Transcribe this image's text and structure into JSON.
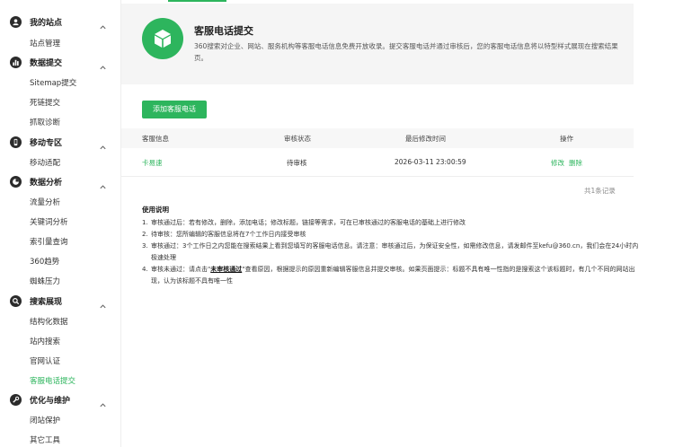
{
  "sidebar": {
    "sections": [
      {
        "title": "我的站点",
        "items": [
          "站点管理"
        ]
      },
      {
        "title": "数据提交",
        "items": [
          "Sitemap提交",
          "死链提交",
          "抓取诊断"
        ]
      },
      {
        "title": "移动专区",
        "items": [
          "移动适配"
        ]
      },
      {
        "title": "数据分析",
        "items": [
          "流量分析",
          "关键词分析",
          "索引量查询",
          "360趋势",
          "蜘蛛压力"
        ]
      },
      {
        "title": "搜索展现",
        "items": [
          "结构化数据",
          "站内搜索",
          "官网认证",
          "客服电话提交"
        ]
      },
      {
        "title": "优化与维护",
        "items": [
          "闭站保护",
          "其它工具"
        ]
      }
    ],
    "active_item": "客服电话提交"
  },
  "header": {
    "title": "客服电话提交",
    "description": "360搜索对企业、网站、服务机构等客服电话信息免费开放收录。提交客服电话并通过审核后，您的客服电话信息将以特型样式展现在搜索结果页。"
  },
  "toolbar": {
    "add_label": "添加客服电话"
  },
  "table": {
    "headers": [
      "客服信息",
      "审核状态",
      "最后修改时间",
      "操作"
    ],
    "rows": [
      {
        "info": "卡易速",
        "status": "待审核",
        "time": "2026-03-11 23:00:59",
        "edit": "修改",
        "delete": "删除"
      }
    ],
    "total": "共1条记录"
  },
  "notes": {
    "title": "使用说明",
    "items": [
      {
        "num": "1.",
        "text": "审核通过后：若有修改，删除，添加电话；修改标题，链接等需求，可在已审核通过的客服电话的基础上进行修改"
      },
      {
        "num": "2.",
        "text": "待审核：您所编辑的客服信息将在7个工作日内接受审核"
      },
      {
        "num": "3.",
        "text": "审核通过：3个工作日之内您能在搜索结果上看到您填写的客服电话信息。请注意：审核通过后，为保证安全性，如需修改信息，请发邮件至kefu@360.cn，我们会在24小时内极速处理"
      },
      {
        "num": "4.",
        "pre": "审核未通过：请点击\"",
        "bold": "未审核通过",
        "post": "\"查看原因，根据提示的原因重新编辑客服信息并提交审核。如果页面提示：标题不具有唯一性指的是搜索这个该标题时，有几个不同的网站出现，认为该标题不具有唯一性"
      }
    ]
  },
  "colors": {
    "accent": "#2db55d",
    "header_bg": "#f5f5f5",
    "sidebar_icon": "#2b2b2b"
  },
  "icons": [
    "user-icon",
    "bar-chart-icon",
    "mobile-icon",
    "pie-chart-icon",
    "search-icon",
    "tools-icon",
    "chevron-up-icon",
    "cube-icon"
  ]
}
